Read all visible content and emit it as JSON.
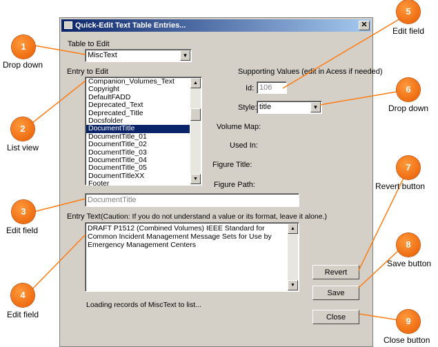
{
  "window": {
    "title": "Quick-Edit Text Table Entries...",
    "close_glyph": "✕"
  },
  "table_to_edit": {
    "label": "Table to Edit",
    "value": "MiscText"
  },
  "entry_to_edit": {
    "label": "Entry to Edit",
    "items": [
      "Companion_Volumes_Text",
      "Copyright",
      "DefaultFADD",
      "Deprecated_Text",
      "Deprecated_Title",
      "Docsfolder",
      "DocumentTitle",
      "DocumentTitle_01",
      "DocumentTitle_02",
      "DocumentTitle_03",
      "DocumentTitle_04",
      "DocumentTitle_05",
      "DocumentTitleXX",
      "Footer"
    ],
    "selected_index": 6
  },
  "supporting": {
    "header": "Supporting Values (edit in Acess if needed)",
    "id_label": "Id:",
    "id_value": "106",
    "style_label": "Style:",
    "style_value": "title",
    "volume_map_label": "Volume Map:",
    "used_in_label": "Used In:",
    "figure_title_label": "Figure Title:",
    "figure_path_label": "Figure Path:"
  },
  "entry_name_field": {
    "value": "DocumentTitle"
  },
  "entry_text": {
    "label": "Entry Text",
    "caution": "(Caution: If you do not understand a value or its format, leave it alone.)",
    "value": "DRAFT P1512 (Combined Volumes) IEEE Standard for Common Incident Management Message Sets for Use by Emergency Management Centers"
  },
  "status": "Loading records of MiscText to list...",
  "buttons": {
    "revert": "Revert",
    "save": "Save",
    "close": "Close"
  },
  "callouts": [
    {
      "num": "1",
      "text": "Drop down"
    },
    {
      "num": "2",
      "text": "List view"
    },
    {
      "num": "3",
      "text": "Edit field"
    },
    {
      "num": "4",
      "text": "Edit field"
    },
    {
      "num": "5",
      "text": "Edit field"
    },
    {
      "num": "6",
      "text": "Drop down"
    },
    {
      "num": "7",
      "text": "Revert button"
    },
    {
      "num": "8",
      "text": "Save button"
    },
    {
      "num": "9",
      "text": "Close button"
    }
  ],
  "colors": {
    "callout": "#ff7a10",
    "titlebar": "#0a246a",
    "selection": "#0a246a",
    "dialog": "#d4d0c8"
  }
}
